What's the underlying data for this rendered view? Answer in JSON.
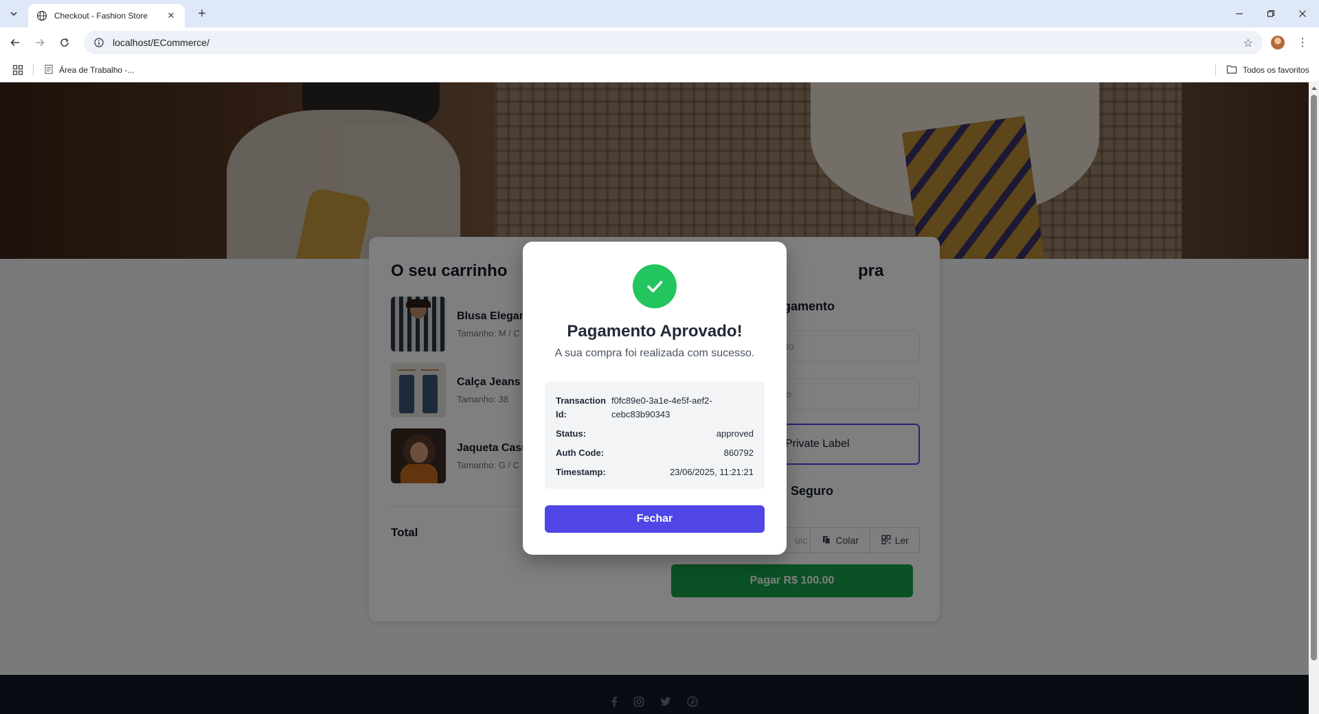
{
  "browser": {
    "tab_title": "Checkout - Fashion Store",
    "url": "localhost/ECommerce/",
    "bookmark_label": "Área de Trabalho -...",
    "bookmarks_folder_label": "Todos os favoritos"
  },
  "cart": {
    "title": "O seu carrinho",
    "items": [
      {
        "name": "Blusa Elegan",
        "size": "Tamanho: M / C"
      },
      {
        "name": "Calça Jeans",
        "size": "Tamanho: 38"
      },
      {
        "name": "Jaqueta Casu",
        "size": "Tamanho: G / C"
      }
    ],
    "total_label": "Total"
  },
  "payment": {
    "summary_title_fragment": "pra",
    "method_title_fragment": "e pagamento",
    "field1_placeholder_fragment": "to",
    "field2_placeholder_fragment": "o",
    "private_label_fragment": "Private Label",
    "secure_title_fragment": "artão Seguro",
    "input_fragment": "uic",
    "paste_label": "Colar",
    "read_label": "Ler",
    "pay_button": "Pagar R$ 100.00"
  },
  "modal": {
    "title": "Pagamento Aprovado!",
    "subtitle": "A sua compra foi realizada com sucesso.",
    "details": {
      "transaction_label": "Transaction Id:",
      "transaction_value": "f0fc89e0-3a1e-4e5f-aef2-cebc83b90343",
      "status_label": "Status:",
      "status_value": "approved",
      "auth_label": "Auth Code:",
      "auth_value": "860792",
      "timestamp_label": "Timestamp:",
      "timestamp_value": "23/06/2025, 11:21:21"
    },
    "close_button": "Fechar"
  },
  "colors": {
    "accent": "#4f46e5",
    "success": "#22c55e",
    "pay_button": "#16a34a",
    "footer": "#111827"
  },
  "icons": [
    "tab-search-icon",
    "globe-icon",
    "close-icon",
    "plus-icon",
    "back-icon",
    "forward-icon",
    "reload-icon",
    "site-info-icon",
    "star-icon",
    "apps-icon",
    "folder-icon",
    "check-icon",
    "paste-icon",
    "qr-icon",
    "facebook-icon",
    "instagram-icon",
    "twitter-icon",
    "pinterest-icon"
  ]
}
